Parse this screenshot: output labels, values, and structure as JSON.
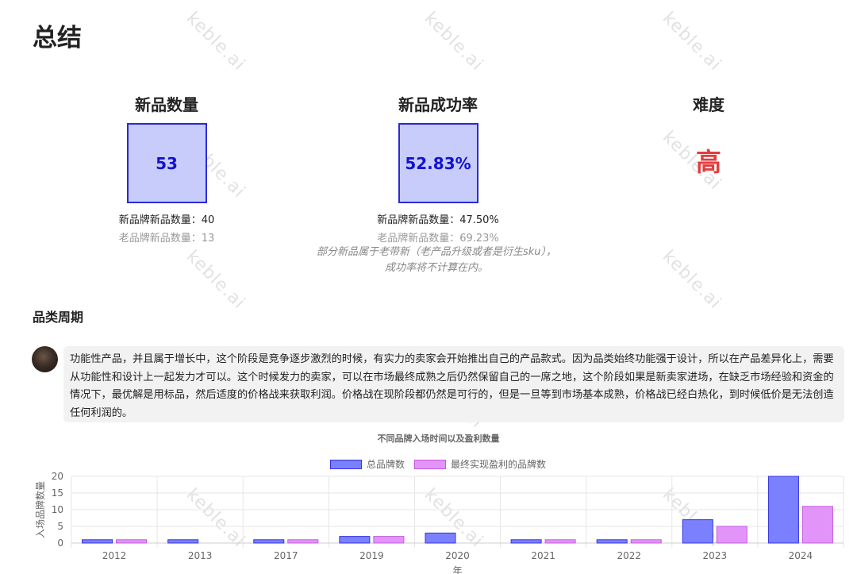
{
  "page": {
    "title": "总结",
    "watermark": "keble.ai"
  },
  "metrics": [
    {
      "title": "新品数量",
      "value": "53",
      "line1": "新品牌新品数量：40",
      "line2": "老品牌新品数量：13"
    },
    {
      "title": "新品成功率",
      "value": "52.83%",
      "line1": "新品牌新品数量：47.50%",
      "line2": "老品牌新品数量：69.23%"
    },
    {
      "title": "难度",
      "value": "高"
    }
  ],
  "note": {
    "line1": "部分新品属于老带新（老产品升级或者是衍生sku），",
    "line2": "成功率将不计算在内。"
  },
  "section": {
    "title": "品类周期",
    "message": "功能性产品，并且属于增长中，这个阶段是竞争逐步激烈的时候，有实力的卖家会开始推出自己的产品款式。因为品类始终功能强于设计，所以在产品差异化上，需要从功能性和设计上一起发力才可以。这个时候发力的卖家，可以在市场最终成熟之后仍然保留自己的一席之地，这个阶段如果是新卖家进场，在缺乏市场经验和资金的情况下，最优解是用标品，然后适度的价格战来获取利润。价格战在现阶段都仍然是可行的，但是一旦等到市场基本成熟，价格战已经白热化，到时候低价是无法创造任何利润的。"
  },
  "chart_data": {
    "type": "bar",
    "title": "不同品牌入场时间以及盈利数量",
    "xlabel": "年",
    "ylabel": "入场品牌数量",
    "categories": [
      "2012",
      "2013",
      "2017",
      "2019",
      "2020",
      "2021",
      "2022",
      "2023",
      "2024"
    ],
    "series": [
      {
        "name": "总品牌数",
        "values": [
          1,
          1,
          1,
          2,
          3,
          1,
          1,
          7,
          20
        ],
        "color": "#7b80ff",
        "border": "#3434e0"
      },
      {
        "name": "最终实现盈利的品牌数",
        "values": [
          1,
          0,
          1,
          2,
          0,
          1,
          1,
          5,
          11
        ],
        "color": "#e394f8",
        "border": "#c35ce0"
      }
    ],
    "ylim": [
      0,
      20
    ],
    "yticks": [
      0,
      5,
      10,
      15,
      20
    ],
    "grid": true,
    "legend": "top"
  }
}
